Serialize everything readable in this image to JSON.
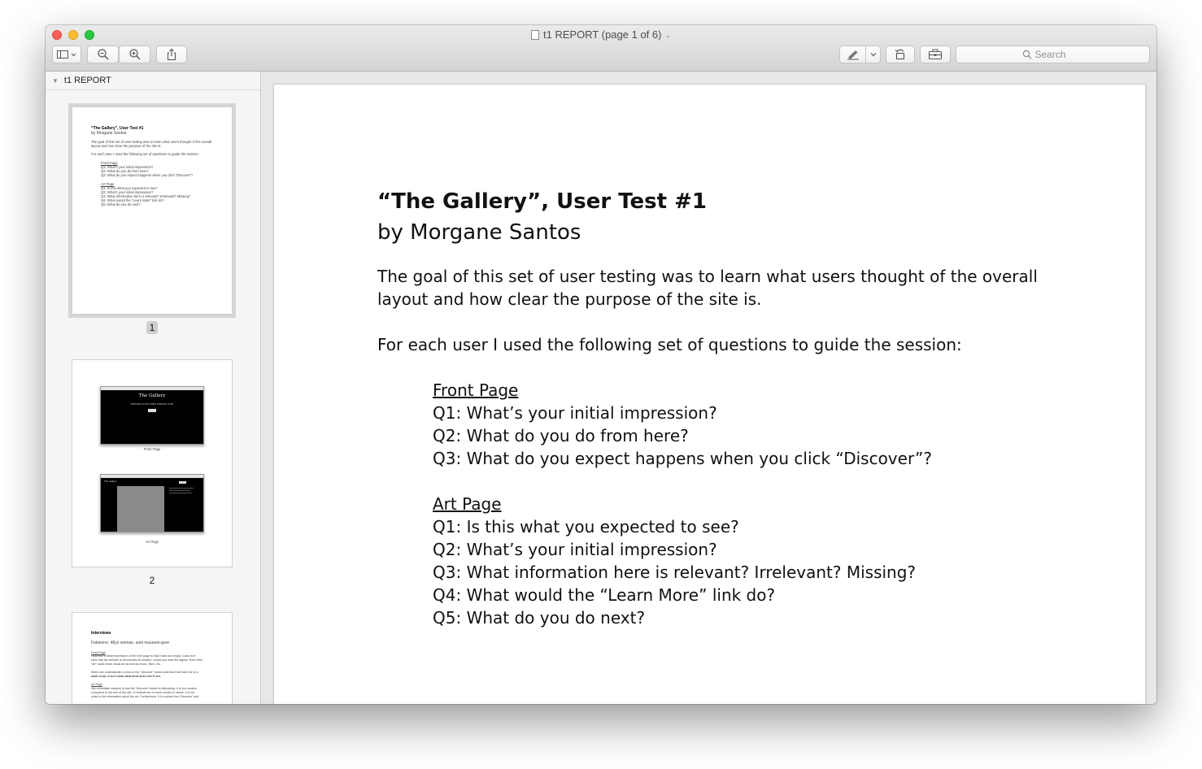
{
  "window": {
    "title": "t1 REPORT (page 1 of 6)"
  },
  "toolbar": {
    "search_placeholder": "Search",
    "icons": [
      "sidebar-toggle-icon",
      "zoom-out-icon",
      "zoom-in-icon",
      "share-icon",
      "markup-pen-icon",
      "rotate-icon",
      "toolbox-icon",
      "search-icon"
    ]
  },
  "sidebar": {
    "header": "t1 REPORT",
    "pages": [
      {
        "number": "1"
      },
      {
        "number": "2"
      }
    ],
    "thumb1": {
      "title": "“The Gallery”, User Test #1",
      "author": "by Morgane Santos",
      "goal_1": "The goal of this set of user testing was to learn what users thought of the overall",
      "goal_2": "layout and how clear the purpose of the site is.",
      "intro": "For each user I used the following set of questions to guide the session:",
      "front": "Front Page",
      "fq1": "Q1: What’s your initial impression?",
      "fq2": "Q2: What do you do from here?",
      "fq3": "Q3: What do you expect happens when you click “Discover”?",
      "art": "Art Page",
      "aq1": "Q1: Is this what you expected to see?",
      "aq2": "Q2: What’s your initial impression?",
      "aq3": "Q3: What information here is relevant? Irrelevant? Missing?",
      "aq4": "Q4: What would the “Learn More” link do?",
      "aq5": "Q5: What do you do next?"
    },
    "thumb2": {
      "shot1_heading": "The Gallery",
      "shot1_sub": "Welcome to the online museum of art",
      "caption1": "Front Page",
      "shot2_heading": "The Gallery",
      "caption2": "Art Page"
    },
    "thumb3": {
      "heading": "Interviews",
      "person": "Fabienne: 48yo woman, avid museum-goer",
      "section1": "Front Page",
      "line1": "Fabienne’s initial impression of the front page is that it was too empty. It also isn’t",
      "line2": "clear that the website is necessarily art-related, unless you read the tagline. Even then,",
      "line3": "“art” could mean visual art as well as music, films, etc.",
      "line4": "While she understands to click on the “Discover” button and that it will take her to a",
      "line5": "work of art, it isn’t clear what kind of art she’ll see.",
      "section2": "Art Page",
      "line6": "Her immediate reaction is that the “Discover” button is distracting. It is too modern",
      "line7": "compared to the rest of the site. It reminds her of comic books or nature, it is too",
      "line8": "close to the information about the art. Furthermore, it is unclear how “Discover” and"
    }
  },
  "document": {
    "title": "“The Gallery”, User Test #1",
    "author": "by Morgane Santos",
    "goal_line1": "The goal of this set of user testing was to learn what users thought of the overall",
    "goal_line2": "layout and how clear the purpose of the site is.",
    "intro": "For each user I used the following set of questions to guide the session:",
    "front_page": {
      "heading": "Front Page",
      "q1": "Q1: What’s your initial impression?",
      "q2": "Q2: What do you do from here?",
      "q3": "Q3: What do you expect happens when you click “Discover”?"
    },
    "art_page": {
      "heading": "Art Page",
      "q1": "Q1: Is this what you expected to see?",
      "q2": "Q2: What’s your initial impression?",
      "q3": "Q3: What information here is relevant? Irrelevant? Missing?",
      "q4": "Q4: What would the “Learn More” link do?",
      "q5": "Q5: What do you do next?"
    }
  },
  "colors": {
    "close": "#fc5f57",
    "minimize": "#fdbc2e",
    "maximize": "#29c941"
  }
}
